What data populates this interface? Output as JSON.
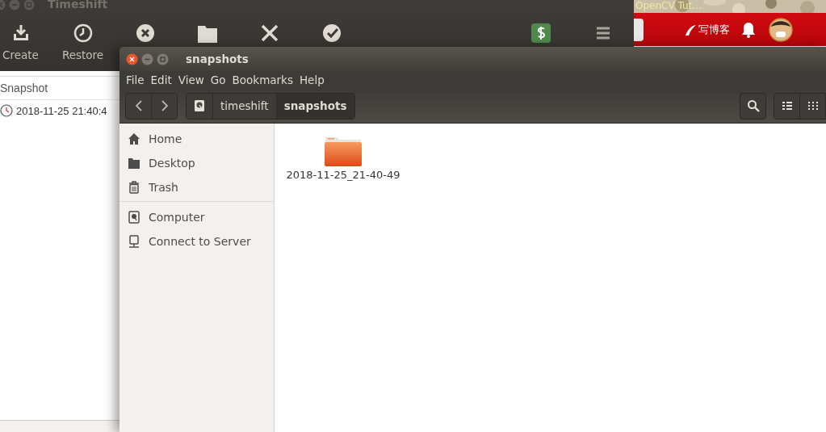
{
  "timeshift": {
    "title": "Timeshift",
    "toolbar": [
      {
        "kind": "create",
        "label": "Create"
      },
      {
        "kind": "restore",
        "label": "Restore"
      },
      {
        "kind": "delete"
      },
      {
        "kind": "browse"
      },
      {
        "kind": "settings"
      },
      {
        "kind": "wizard"
      },
      {
        "kind": "donate"
      },
      {
        "kind": "menu"
      }
    ],
    "table": {
      "columns": [
        "Snapshot"
      ],
      "rows": [
        {
          "cells": [
            "2018-11-25 21:40:4"
          ]
        }
      ]
    }
  },
  "browser": {
    "banner_text": "OpenCV Tut…",
    "write_label": "写博客"
  },
  "files": {
    "title": "snapshots",
    "menu": [
      "File",
      "Edit",
      "View",
      "Go",
      "Bookmarks",
      "Help"
    ],
    "path": [
      {
        "kind": "drive"
      },
      {
        "kind": "folder",
        "label": "timeshift",
        "selected": false
      },
      {
        "kind": "folder",
        "label": "snapshots",
        "selected": true
      }
    ],
    "sidebar": [
      [
        {
          "kind": "home",
          "label": "Home"
        },
        {
          "kind": "desktop",
          "label": "Desktop"
        },
        {
          "kind": "trash",
          "label": "Trash"
        }
      ],
      [
        {
          "kind": "computer",
          "label": "Computer"
        },
        {
          "kind": "server",
          "label": "Connect to Server"
        }
      ]
    ],
    "items": [
      {
        "name": "2018-11-25_21-40-49"
      }
    ]
  }
}
